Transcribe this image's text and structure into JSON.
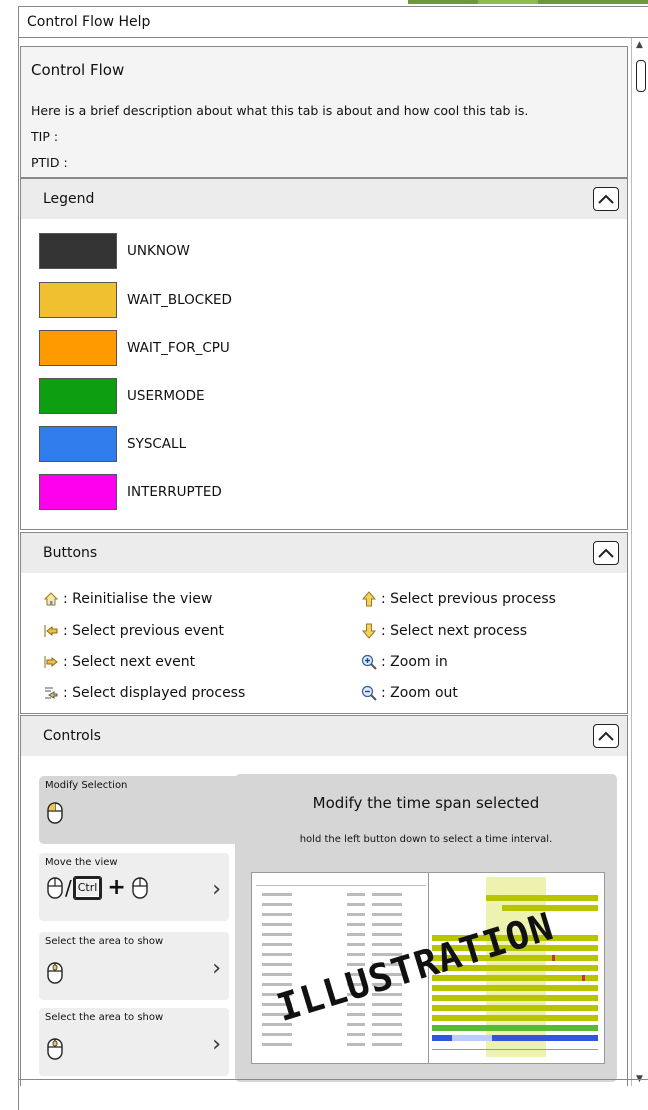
{
  "window": {
    "title": "Control Flow Help"
  },
  "info": {
    "title": "Control Flow",
    "description": "Here is a brief description about what this tab is about and how cool this tab is.",
    "tip": "TIP :",
    "ptid": "PTID :"
  },
  "legend": {
    "header": "Legend",
    "items": [
      {
        "label": "UNKNOW",
        "color": "#333333"
      },
      {
        "label": "WAIT_BLOCKED",
        "color": "#f0c030"
      },
      {
        "label": "WAIT_FOR_CPU",
        "color": "#ff9a00"
      },
      {
        "label": "USERMODE",
        "color": "#0d9e12"
      },
      {
        "label": "SYSCALL",
        "color": "#2f7ded"
      },
      {
        "label": "INTERRUPTED",
        "color": "#ff00ee"
      }
    ]
  },
  "buttons": {
    "header": "Buttons",
    "left": [
      {
        "icon": "home-icon",
        "text": ": Reinitialise the view"
      },
      {
        "icon": "previous-event-icon",
        "text": ": Select previous event"
      },
      {
        "icon": "next-event-icon",
        "text": ": Select next event"
      },
      {
        "icon": "displayed-process-icon",
        "text": ": Select displayed process"
      }
    ],
    "right": [
      {
        "icon": "arrow-up-icon",
        "text": ": Select previous process"
      },
      {
        "icon": "arrow-down-icon",
        "text": ": Select next process"
      },
      {
        "icon": "zoom-in-icon",
        "text": ": Zoom in"
      },
      {
        "icon": "zoom-out-icon",
        "text": ": Zoom out"
      }
    ]
  },
  "controls": {
    "header": "Controls",
    "cards": [
      {
        "caption": "Modify Selection"
      },
      {
        "caption": "Move the view",
        "key": "Ctrl"
      },
      {
        "caption": "Select the area to show"
      },
      {
        "caption": "Select the area to show"
      }
    ],
    "detail_title": "Modify the time span selected",
    "detail_subtitle": "hold the left button down to select a time interval.",
    "illustration_word": "ILLUSTRATION"
  }
}
